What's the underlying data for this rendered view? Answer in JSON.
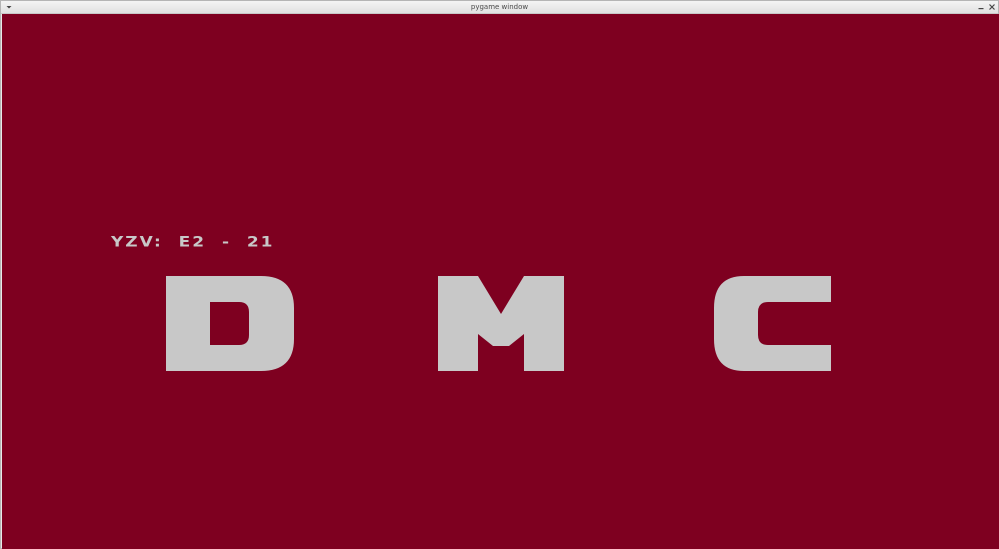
{
  "window": {
    "title": "pygame window",
    "icons": {
      "menu": "chevron-down-icon",
      "minimize": "minimize-icon",
      "close": "close-icon"
    }
  },
  "game": {
    "background_color": "#7e0020",
    "text_color": "#c8c8c8",
    "hud_label": "YZV:  E2  -  21",
    "letters": [
      "D",
      "M",
      "C"
    ]
  }
}
